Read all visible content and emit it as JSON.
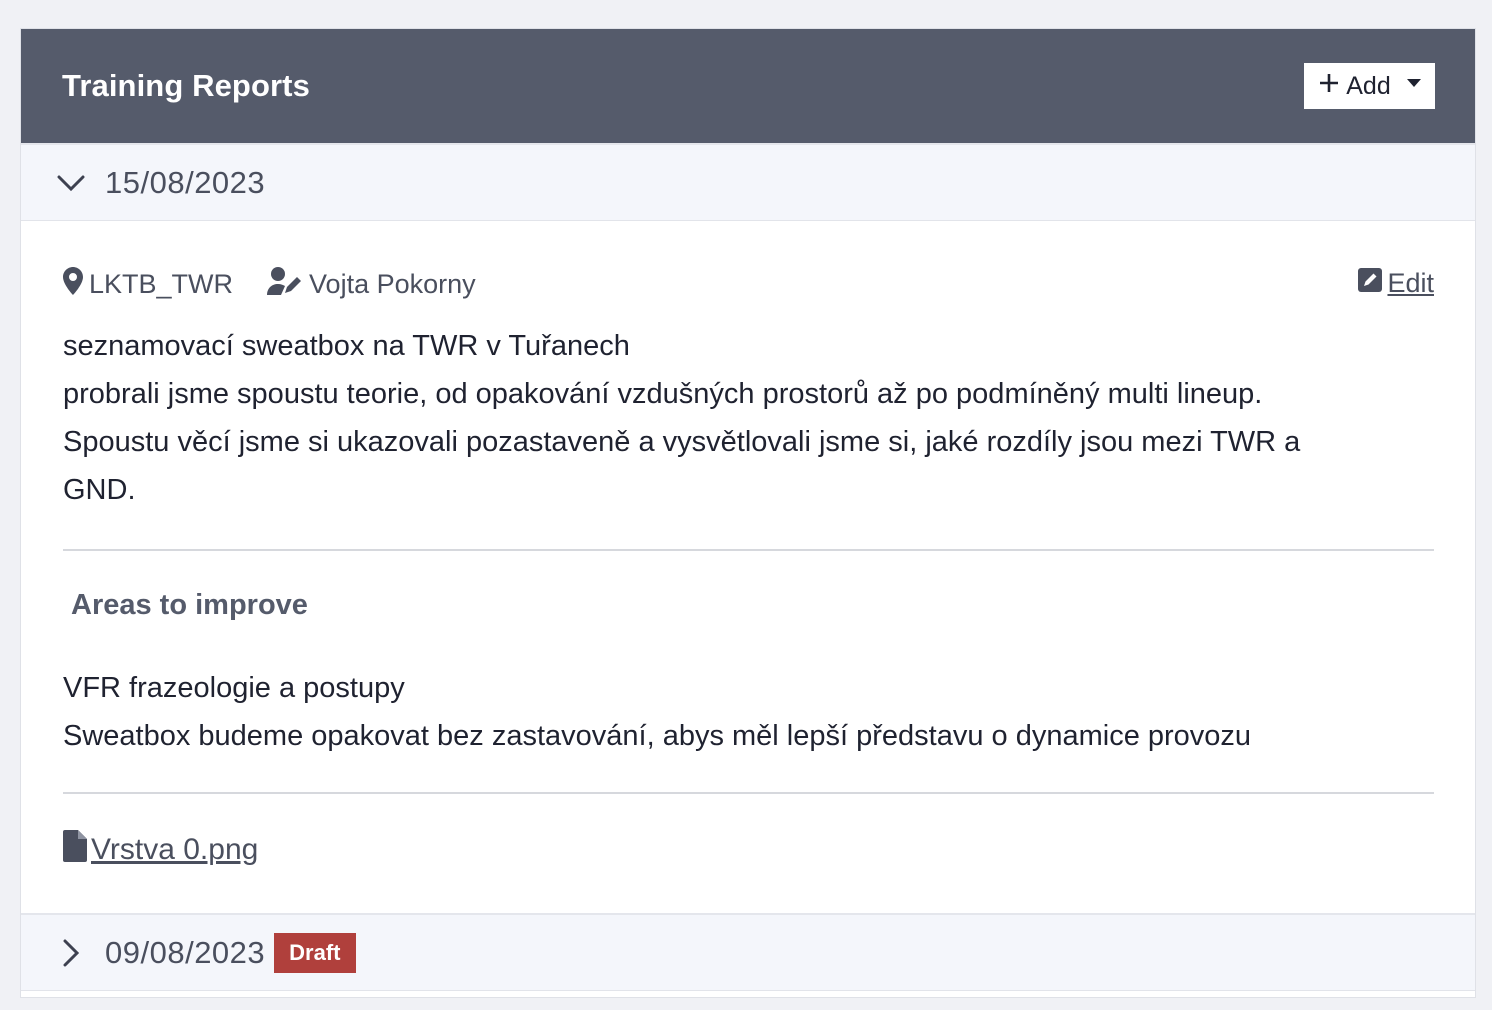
{
  "header": {
    "title": "Training Reports",
    "add_label": "Add"
  },
  "reports": [
    {
      "date": "15/08/2023",
      "expanded": true,
      "location": "LKTB_TWR",
      "mentor": "Vojta Pokorny",
      "edit_label": "Edit",
      "content_lines": [
        "seznamovací sweatbox na TWR v Tuřanech",
        "probrali jsme spoustu teorie, od opakování vzdušných prostorů až po podmíněný multi lineup.",
        "Spoustu věcí jsme si ukazovali pozastaveně a vysvětlovali jsme si, jaké rozdíly jsou mezi TWR a",
        "GND."
      ],
      "areas_title": "Areas to improve",
      "areas_lines": [
        "VFR frazeologie a postupy",
        "Sweatbox budeme opakovat bez zastavování, abys měl lepší představu o dynamice provozu"
      ],
      "attachment": "Vrstva 0.png"
    },
    {
      "date": "09/08/2023",
      "expanded": false,
      "badge": "Draft"
    }
  ],
  "colors": {
    "header_bg": "#555b6b",
    "accordion_bg": "#f4f6fb",
    "draft_badge": "#b0403c"
  }
}
